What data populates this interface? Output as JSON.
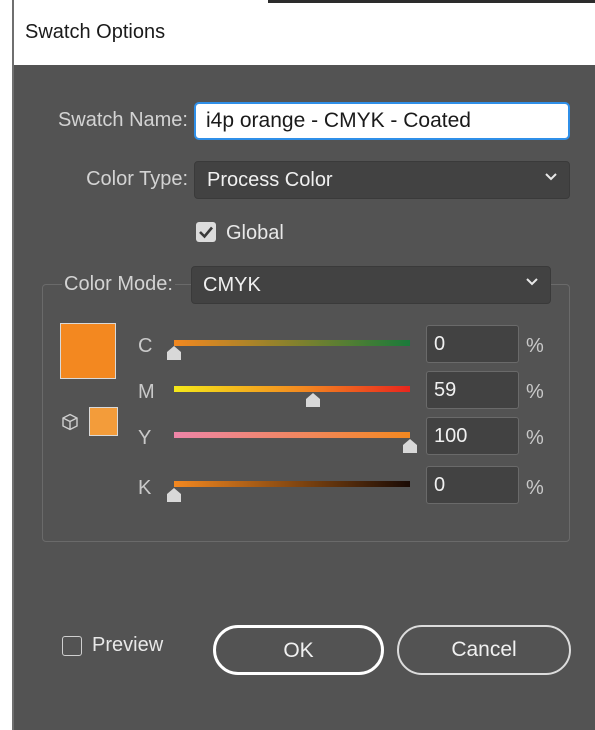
{
  "window": {
    "title": "Swatch Options"
  },
  "form": {
    "swatch_name_label": "Swatch Name:",
    "swatch_name_value": "i4p orange - CMYK - Coated",
    "color_type_label": "Color Type:",
    "color_type_value": "Process Color",
    "global_label": "Global",
    "global_checked": true,
    "color_mode_label": "Color Mode:",
    "color_mode_value": "CMYK"
  },
  "colors": {
    "swatch_main": "#f38820",
    "swatch_alt": "#f39c3a",
    "dialog_bg": "#535353",
    "focus_border": "#2f8fe8"
  },
  "channels": [
    {
      "label": "C",
      "value": "0",
      "unit": "%",
      "fraction": 0.0
    },
    {
      "label": "M",
      "value": "59",
      "unit": "%",
      "fraction": 0.59
    },
    {
      "label": "Y",
      "value": "100",
      "unit": "%",
      "fraction": 1.0
    },
    {
      "label": "K",
      "value": "0",
      "unit": "%",
      "fraction": 0.0
    }
  ],
  "footer": {
    "preview_label": "Preview",
    "preview_checked": false,
    "ok_label": "OK",
    "cancel_label": "Cancel"
  }
}
